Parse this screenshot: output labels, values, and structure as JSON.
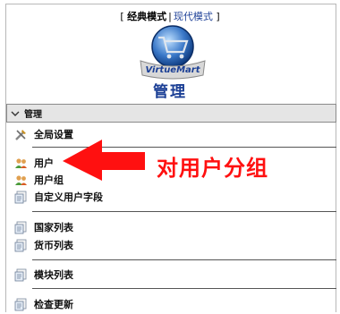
{
  "mode_switch": {
    "open_bracket": "[",
    "classic": "经典模式",
    "separator": "|",
    "modern": "现代模式",
    "close_bracket": "]"
  },
  "logo": {
    "icon": "virtuemart-cart-logo",
    "text": "VirtueMart"
  },
  "page_title": "管理",
  "section": {
    "label": "管理",
    "icon": "chevron-down-icon"
  },
  "menu": [
    {
      "label": "全局设置",
      "icon": "tools-icon"
    },
    {
      "label": "用户",
      "icon": "users-icon"
    },
    {
      "label": "用户组",
      "icon": "users-icon"
    },
    {
      "label": "自定义用户字段",
      "icon": "list-icon"
    },
    {
      "label": "国家列表",
      "icon": "list-icon"
    },
    {
      "label": "货币列表",
      "icon": "list-icon"
    },
    {
      "label": "模块列表",
      "icon": "list-icon"
    },
    {
      "label": "检查更新",
      "icon": "list-icon"
    }
  ],
  "annotation": {
    "text": "对用户分组",
    "color": "#ff1010"
  }
}
